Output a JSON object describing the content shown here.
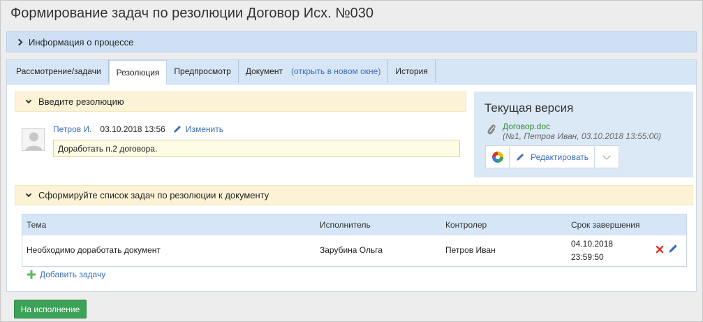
{
  "page_title": "Формирование задач по резолюции Договор Исх. №030",
  "process_info": {
    "label": "Информация о процессе"
  },
  "tabs": [
    {
      "label": "Рассмотрение/задачи"
    },
    {
      "label": "Резолюция"
    },
    {
      "label": "Предпросмотр"
    },
    {
      "label": "Документ",
      "link": "(открыть в новом окне)"
    },
    {
      "label": "История"
    }
  ],
  "resolution": {
    "section_title": "Введите резолюцию",
    "author": "Петров И.",
    "datetime": "03.10.2018 13:56",
    "edit_label": "Изменить",
    "text": "Доработать п.2 договора."
  },
  "current_version": {
    "title": "Текущая версия",
    "file_name": "Договор.doc",
    "file_meta": "(№1, Петров Иван, 03.10.2018 13:55:00)",
    "edit_button": "Редактировать",
    "colors": {
      "file_link": "#2e8b2e"
    }
  },
  "tasks": {
    "section_title": "Сформируйте список задач по резолюции к документу",
    "columns": [
      "Тема",
      "Исполнитель",
      "Контролер",
      "Срок завершения"
    ],
    "rows": [
      {
        "topic": "Необходимо доработать документ",
        "executor": "Зарубина Ольга",
        "controller": "Петров Иван",
        "due_date": "04.10.2018",
        "due_time": "23:59:50"
      }
    ],
    "add_label": "Добавить задачу"
  },
  "submit_button": "На исполнение",
  "colors": {
    "accent": "#3b6fb6",
    "primary": "#3ca257",
    "delete": "#e03131"
  }
}
